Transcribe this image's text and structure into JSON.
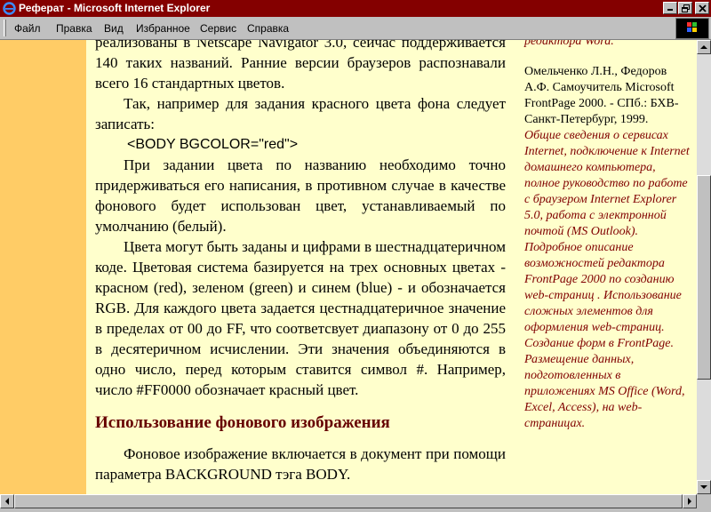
{
  "window": {
    "title": "Реферат - Microsoft Internet Explorer",
    "controls": [
      "minimize-icon",
      "restore-icon",
      "close-icon"
    ],
    "colors": {
      "titlebar": "#840000",
      "page_bg": "#ffffcc",
      "left_strip": "#ffcc66",
      "heading": "#660000",
      "side_italic": "#800000"
    }
  },
  "menu": {
    "items": [
      {
        "label": "Файл"
      },
      {
        "label": "Правка"
      },
      {
        "label": "Вид"
      },
      {
        "label": "Избранное"
      },
      {
        "label": "Сервис"
      },
      {
        "label": "Справка"
      }
    ]
  },
  "main": {
    "p1": "реализованы в Netscape Navigator 3.0, сейчас поддерживается 140 таких названий. Ранние версии браузеров распознавали всего 16 стандартных цветов.",
    "p2": "Так, например для задания красного цвета фона следует записать:",
    "code": "<BODY BGCOLOR=\"red\">",
    "p3": "При задании цвета по названию необходимо точно придерживаться его написания, в противном случае в качестве фонового будет использован цвет, устанавливаемый по умолчанию (белый).",
    "p4": "Цвета могут быть заданы и цифрами в шестнадцатеричном коде. Цветовая система базируется на трех основных цветах - красном (red), зеленом (green) и синем (blue) - и обозначается RGB. Для каждого цвета задается цестнадцатеричное значение в пределах от 00 до FF, что соответсвует диапазону от 0 до 255 в десятеричном исчислении. Эти значения объединяются в одно число, перед которым ставится символ #. Например, число #FF0000 обозначает красный цвет.",
    "heading": "Использование фонового изображения",
    "p5": "Фоновое изображение включается в документ при помощи параметра BACKGROUND тэга BODY."
  },
  "side": {
    "top": "редактора Word.",
    "ref": "Омельченко Л.Н., Федоров А.Ф. Самоучитель Microsoft FrontPage 2000. - СПб.: БХВ-Санкт-Петербург, 1999.",
    "desc": "Общие сведения о сервисах Internet, подключение к Internet домашнего компьютера, полное руководство по работе с браузером Internet Explorer 5.0, работа с электронной почтой (MS Outlook). Подробное описание возможностей редактора FrontPage 2000 по созданию web-страниц . Использование сложных элементов для оформления web-страниц. Создание форм в FrontPage. Размещение данных, подготовленных в приложениях MS Office (Word, Excel, Access), на web-страницах."
  }
}
